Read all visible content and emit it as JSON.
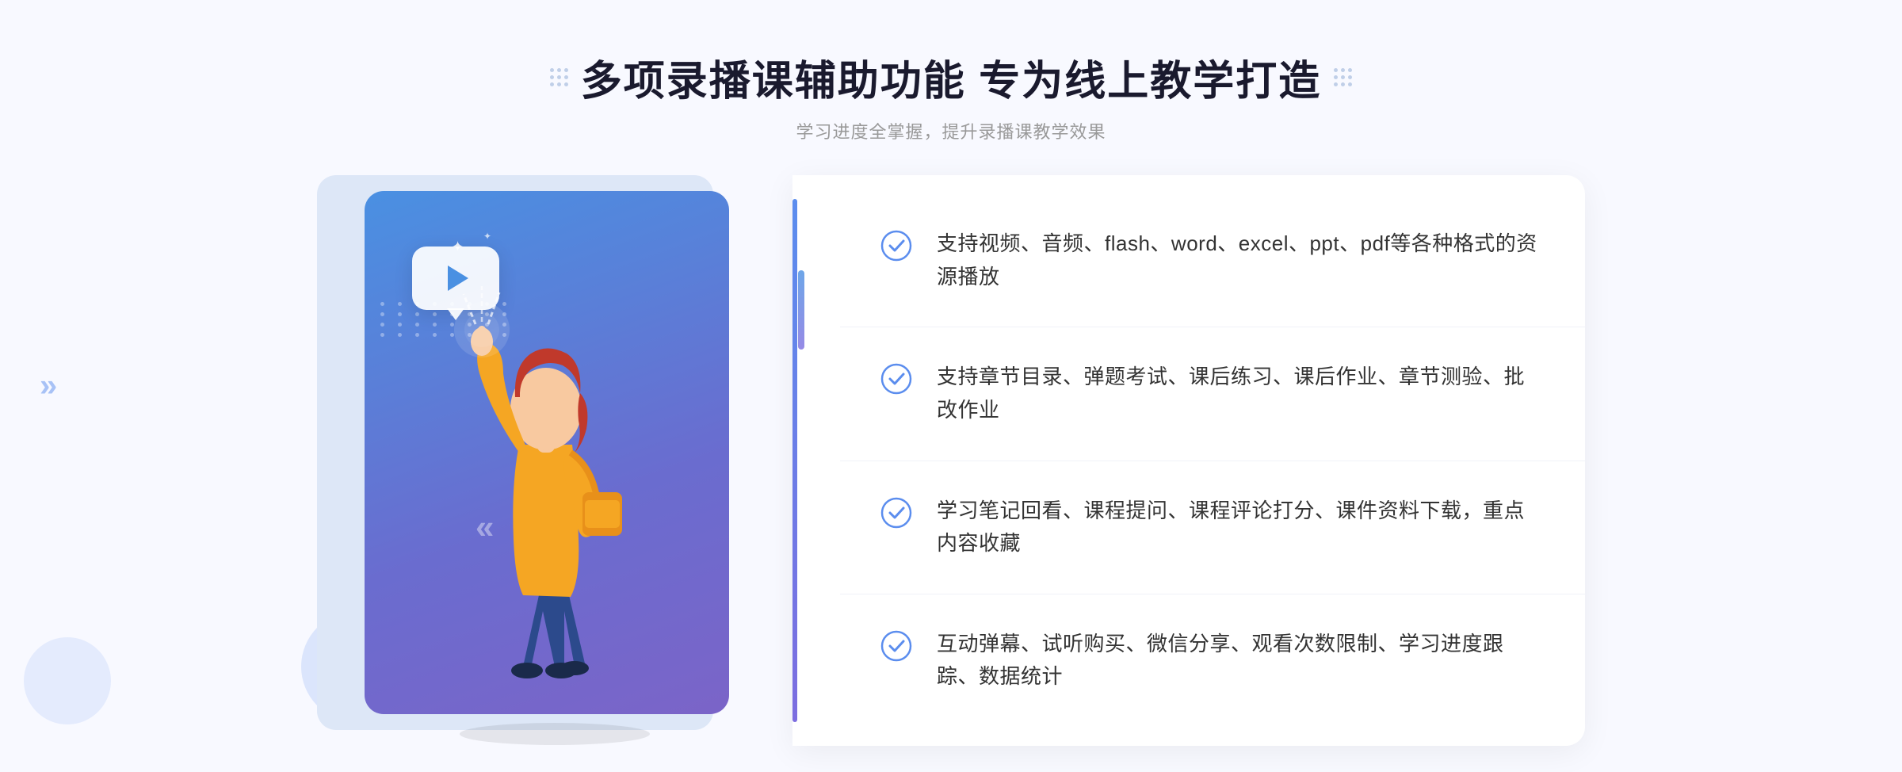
{
  "header": {
    "title": "多项录播课辅助功能 专为线上教学打造",
    "subtitle": "学习进度全掌握，提升录播课教学效果"
  },
  "features": [
    {
      "id": "feature-1",
      "text": "支持视频、音频、flash、word、excel、ppt、pdf等各种格式的资源播放"
    },
    {
      "id": "feature-2",
      "text": "支持章节目录、弹题考试、课后练习、课后作业、章节测验、批改作业"
    },
    {
      "id": "feature-3",
      "text": "学习笔记回看、课程提问、课程评论打分、课件资料下载，重点内容收藏"
    },
    {
      "id": "feature-4",
      "text": "互动弹幕、试听购买、微信分享、观看次数限制、学习进度跟踪、数据统计"
    }
  ],
  "decorations": {
    "dots_label": ":::",
    "chevron": "»"
  }
}
